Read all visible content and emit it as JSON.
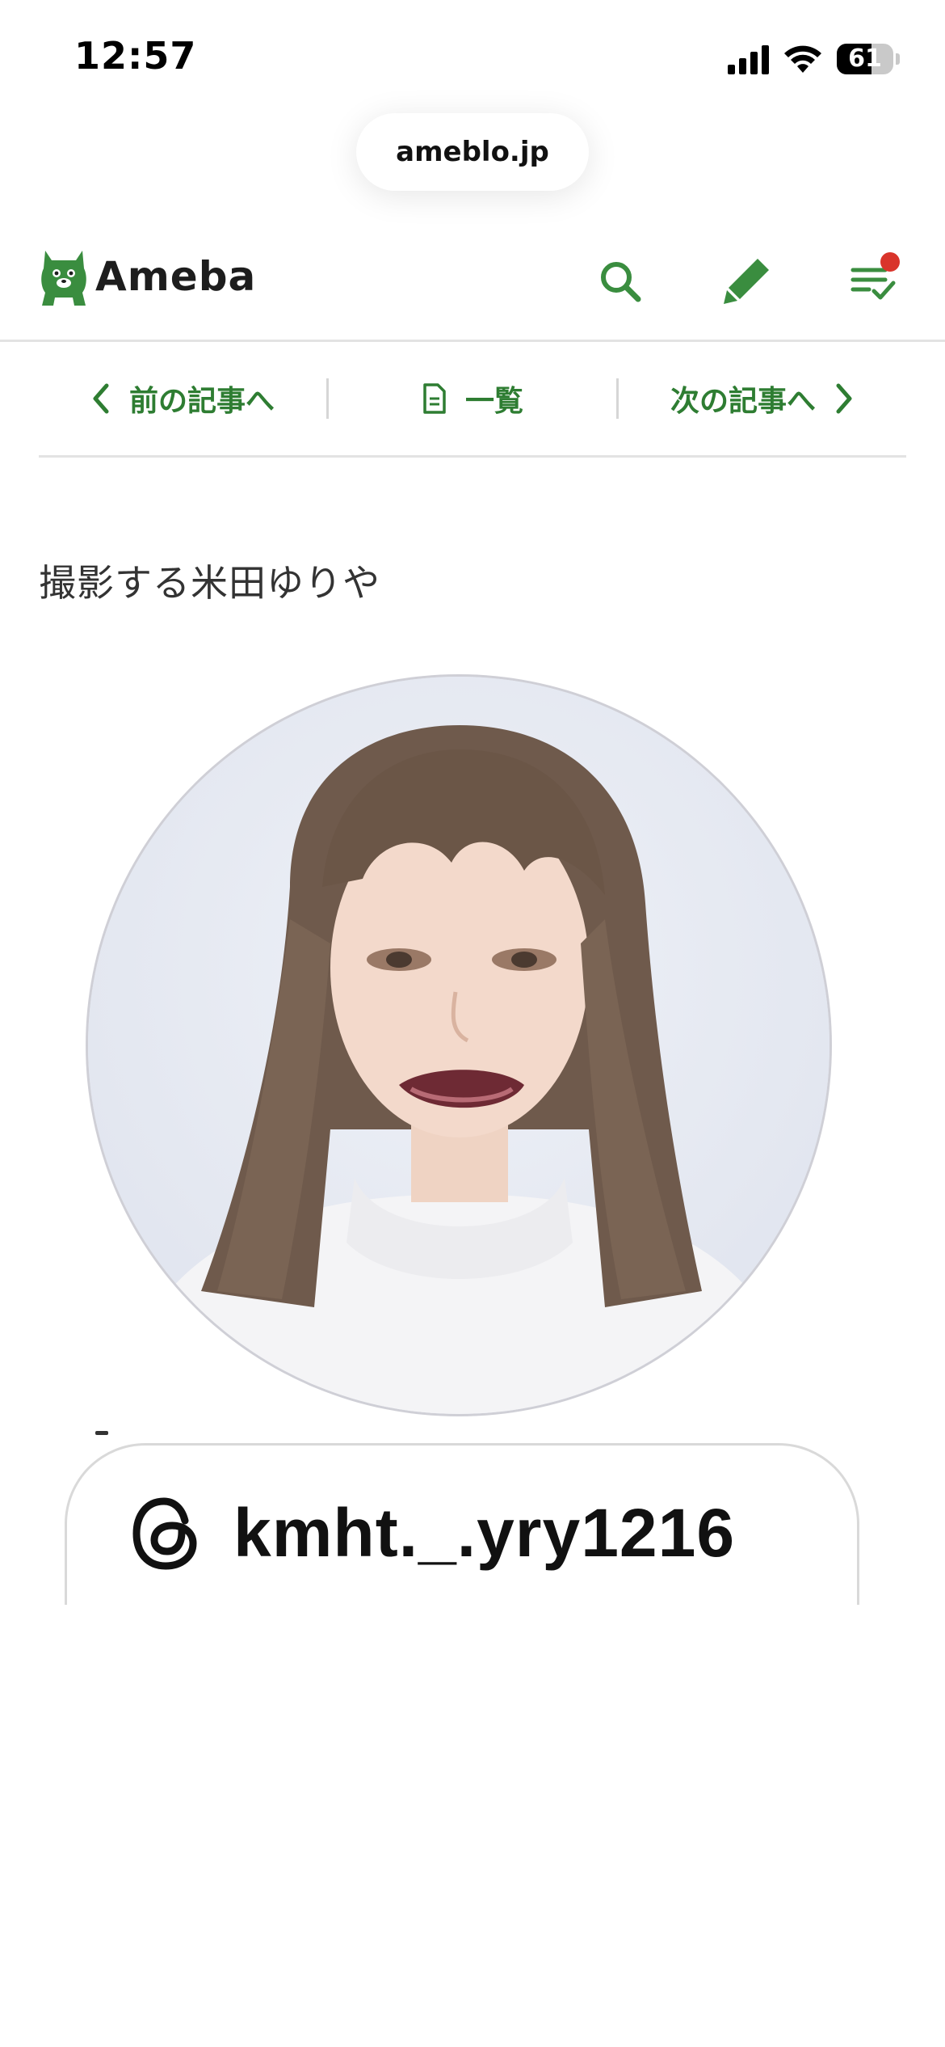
{
  "status_bar": {
    "time": "12:57",
    "battery_level": "61"
  },
  "browser": {
    "url": "ameblo.jp"
  },
  "header": {
    "logo_text": "Ameba",
    "search_icon": "search-icon",
    "edit_icon": "pencil-icon",
    "menu_icon": "checklist-icon",
    "has_notification": true,
    "brand_color": "#3a8d3f",
    "notification_color": "#d9342b"
  },
  "article_nav": {
    "prev_label": "前の記事へ",
    "list_label": "一覧",
    "next_label": "次の記事へ",
    "accent_color": "#2e7d32"
  },
  "article": {
    "title": "撮影する米田ゆりや",
    "threads_handle": "kmht._.yry1216"
  }
}
